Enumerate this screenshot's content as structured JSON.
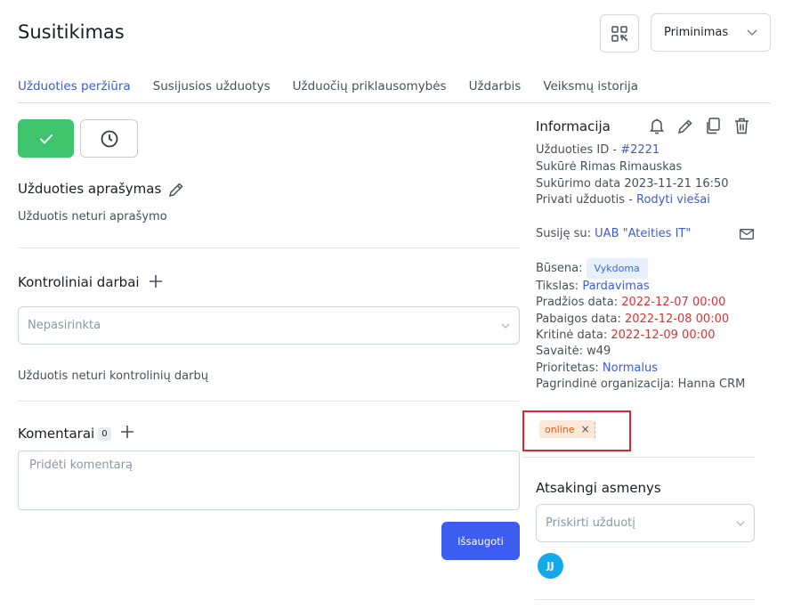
{
  "header": {
    "title": "Susitikimas",
    "reminder_select": "Priminimas"
  },
  "tabs": [
    {
      "label": "Užduoties peržiūra",
      "active": true
    },
    {
      "label": "Susijusios užduotys",
      "active": false
    },
    {
      "label": "Užduočių priklausomybės",
      "active": false
    },
    {
      "label": "Uždarbis",
      "active": false
    },
    {
      "label": "Veiksmų istorija",
      "active": false
    }
  ],
  "description": {
    "title": "Užduoties aprašymas",
    "empty_text": "Užduotis neturi aprašymo"
  },
  "control_works": {
    "title": "Kontroliniai darbai",
    "dropdown_placeholder": "Nepasirinkta",
    "empty_text": "Užduotis neturi kontrolinių darbų"
  },
  "comments": {
    "title": "Komentarai",
    "count": "0",
    "placeholder": "Pridėti komentarą",
    "save_label": "Išsaugoti"
  },
  "info": {
    "title": "Informacija",
    "task_id_label": "Užduoties ID - ",
    "task_id": "#2221",
    "created_by": "Sukūrė Rimas Rimauskas",
    "created_date": "Sukūrimo data 2023-11-21 16:50",
    "private_label": "Privati užduotis - ",
    "private_link": "Rodyti viešai",
    "related_label": "Susiję su: ",
    "related_link": "UAB \"Ateities IT\"",
    "status_label": "Būsena:",
    "status_value": "Vykdoma",
    "goal_label": "Tikslas: ",
    "goal_value": "Pardavimas",
    "start_label": "Pradžios data: ",
    "start_value": "2022-12-07 00:00",
    "end_label": "Pabaigos data: ",
    "end_value": "2022-12-08 00:00",
    "critical_label": "Kritinė data: ",
    "critical_value": "2022-12-09 00:00",
    "week": "Savaitė: w49",
    "priority_label": "Prioritetas: ",
    "priority_value": "Normalus",
    "org": "Pagrindinė organizacija: Hanna CRM"
  },
  "tags": [
    {
      "label": "online",
      "remove": "×"
    }
  ],
  "responsible": {
    "title": "Atsakingi asmenys",
    "placeholder": "Priskirti užduotį",
    "avatar_initials": "JJ"
  },
  "colors": {
    "accent": "#3b5bdb",
    "success": "#3dc46c",
    "primary_button": "#3d5cf0",
    "danger": "#e03131",
    "avatar": "#13a8e8"
  }
}
